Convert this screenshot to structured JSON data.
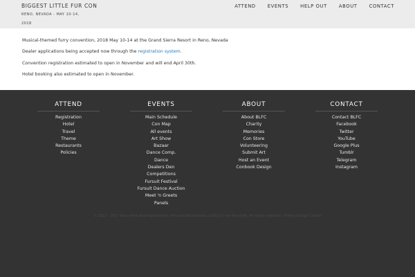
{
  "header": {
    "title": "BIGGEST LITTLE FUR CON",
    "tagline": "RENO, NEVADA - MAY 10-14, 2018",
    "nav": [
      "ATTEND",
      "EVENTS",
      "HELP OUT",
      "ABOUT",
      "CONTACT"
    ]
  },
  "main": {
    "line1": "Musical-themed furry convention, 2018 May 10-14 at the Grand Sierra Resort in Reno, Nevada",
    "line2_prefix": "Dealer applications being accepted now through the ",
    "line2_link": "registration system",
    "line2_suffix": ".",
    "line3": "Convention registration estimated to open in November and will end April 30th.",
    "line4": "Hotel booking also estimated to open in November."
  },
  "footer": {
    "columns": [
      {
        "title": "ATTEND",
        "links": [
          "Registration",
          "Hotel",
          "Travel",
          "Theme",
          "Restaurants",
          "Policies"
        ]
      },
      {
        "title": "EVENTS",
        "links": [
          "Main Schedule",
          "Con Map",
          "All events",
          "Art Show",
          "Bazaar",
          "Dance Comp.",
          "Dance",
          "Dealers Den",
          "Competitions",
          "Fursuit Festival",
          "Fursuit Dance Auction",
          "Meet 'n Greets",
          "Panels"
        ]
      },
      {
        "title": "ABOUT",
        "links": [
          "About BLFC",
          "Charity",
          "Memories",
          "Con Store",
          "Volunteering",
          "Submit Art",
          "Host an Event",
          "Conbook Design"
        ]
      },
      {
        "title": "CONTACT",
        "links": [
          "Contact BLFC",
          "Facebook",
          "Twitter",
          "YouTube",
          "Google Plus",
          "Tumblr",
          "Telegram",
          "Instagram"
        ]
      }
    ],
    "copyright": "© 2012 - 2017 Reno Area Anthropomorphic Arts and Recreations a 501(c)7 not-for-profit. All rights reserved. Theme Design Credits"
  }
}
